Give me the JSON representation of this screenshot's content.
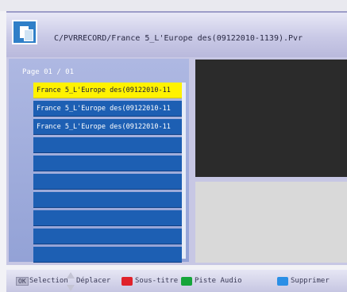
{
  "header": {
    "icon": "file-icon",
    "path": "C/PVRRECORD/France 5_L'Europe des(09122010-1139).Pvr"
  },
  "list": {
    "page_label": "Page  01 / 01",
    "items": [
      "France 5_L'Europe des(09122010-11",
      "France 5_L'Europe des(09122010-11",
      "France 5_L'Europe des(09122010-11",
      "",
      "",
      "",
      "",
      "",
      "",
      ""
    ],
    "selected_index": 0
  },
  "footer": {
    "ok_key": "OK",
    "selection": "Selection",
    "move": "Déplacer",
    "subtitle": "Sous-titre",
    "audio": "Piste Audio",
    "delete": "Supprimer"
  },
  "colors": {
    "selected": "#fff200",
    "row": "#1d5fb3",
    "red": "#e0222b",
    "green": "#16a53a",
    "blue": "#2b8fe6"
  }
}
